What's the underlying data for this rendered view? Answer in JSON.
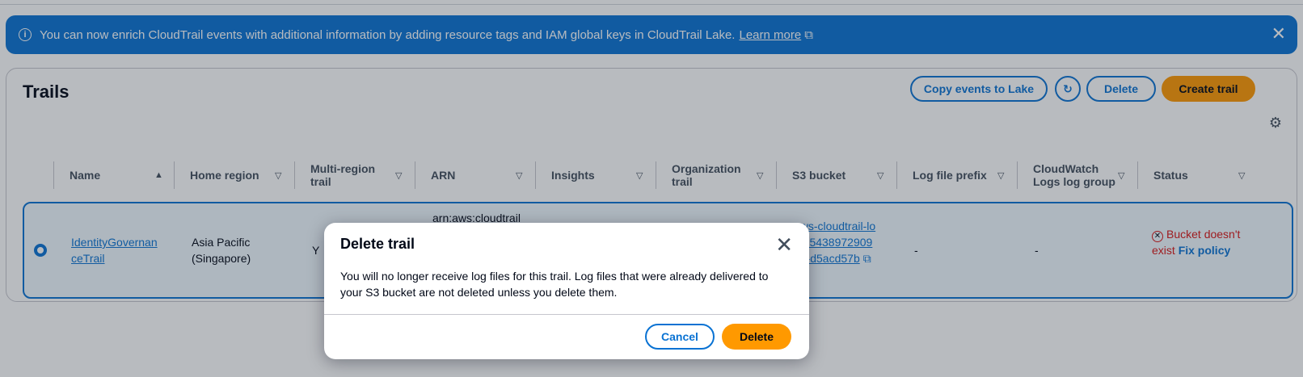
{
  "banner": {
    "message": "You can now enrich CloudTrail events with additional information by adding resource tags and IAM global keys in CloudTrail Lake.",
    "link": "Learn more"
  },
  "trails": {
    "title": "Trails",
    "actions": {
      "copy": "Copy events to Lake",
      "delete": "Delete",
      "create": "Create trail"
    },
    "columns": [
      "Name",
      "Home region",
      "Multi-region trail",
      "ARN",
      "Insights",
      "Organization trail",
      "S3 bucket",
      "Log file prefix",
      "CloudWatch Logs log group",
      "Status"
    ],
    "row": {
      "name": "IdentityGovernanceTrail",
      "home_region": "Asia Pacific (Singapore)",
      "multi_region": "Y",
      "arn": "arn:aws:cloudtrail",
      "s3_bucket": "aws-cloudtrail-logs-543897290976-d5acd57b",
      "log_prefix": "-",
      "cloudwatch": "-",
      "status_error": "Bucket doesn't exist",
      "status_link": "Fix policy"
    }
  },
  "modal": {
    "title": "Delete trail",
    "body": "You will no longer receive log files for this trail. Log files that were already delivered to your S3 bucket are not deleted unless you delete them.",
    "cancel": "Cancel",
    "confirm": "Delete"
  },
  "colors": {
    "primary": "#0972d3",
    "accent": "#ff9900",
    "error": "#d91515"
  },
  "icons": [
    "info-icon",
    "external-link-icon",
    "close-icon",
    "refresh-icon",
    "gear-icon",
    "sort-asc-icon",
    "sort-icon",
    "radio-icon",
    "error-icon"
  ]
}
